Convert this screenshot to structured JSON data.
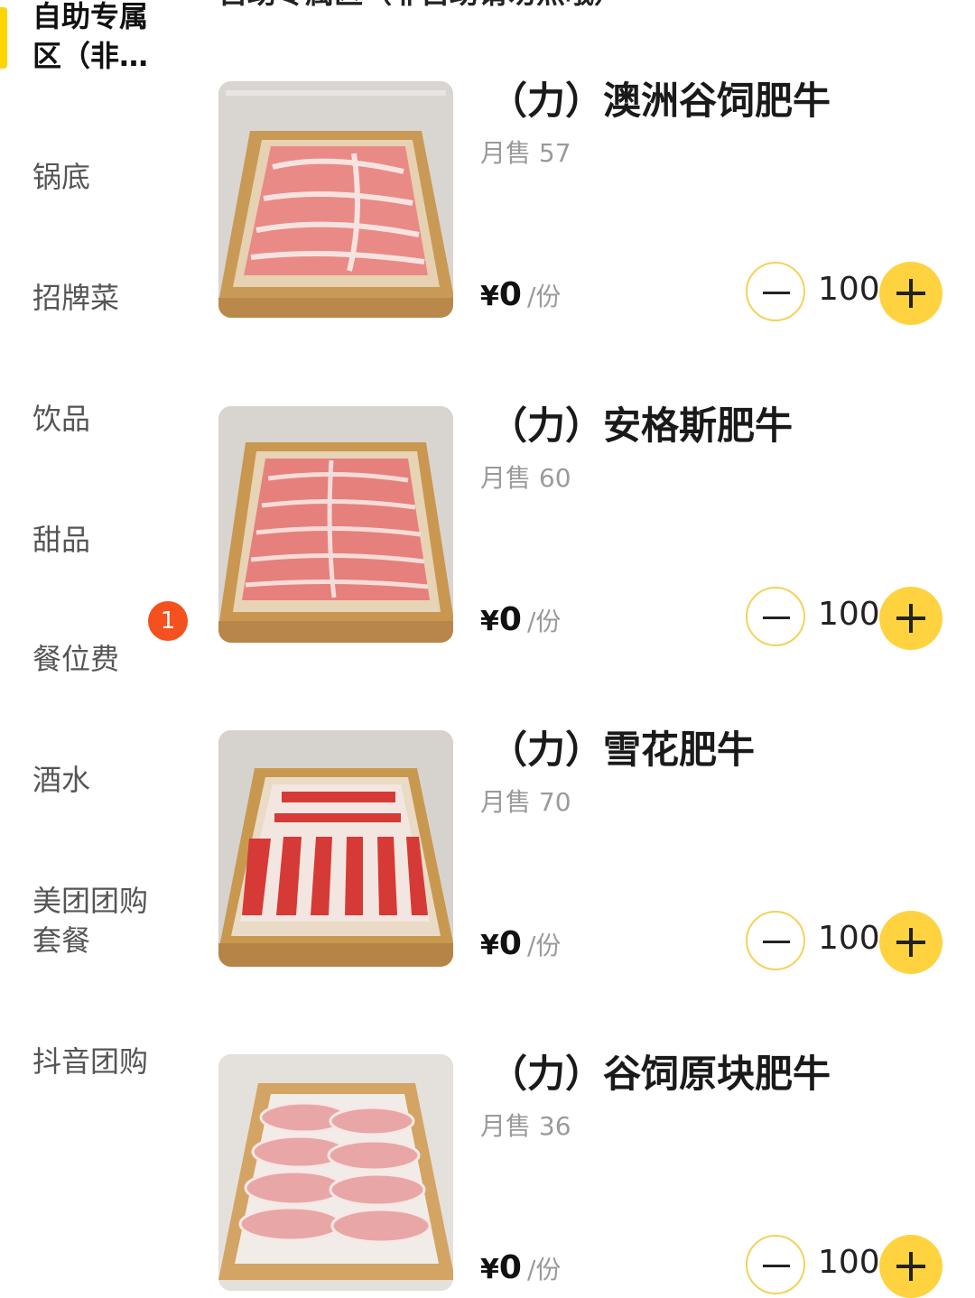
{
  "section_title": "自助专属区（非自助请勿点哦）",
  "sidebar": {
    "items": [
      {
        "label": "自助专属\n区（非…",
        "active": true
      },
      {
        "label": "锅底"
      },
      {
        "label": "招牌菜"
      },
      {
        "label": "饮品"
      },
      {
        "label": "甜品"
      },
      {
        "label": "餐位费",
        "badge": "1"
      },
      {
        "label": "酒水"
      },
      {
        "label": "美团团购\n套餐"
      },
      {
        "label": "抖音团购"
      }
    ]
  },
  "products": [
    {
      "name": "（力）澳洲谷饲肥牛",
      "sales": "月售 57",
      "currency": "¥",
      "price": "0",
      "unit": "/份",
      "qty": "100"
    },
    {
      "name": "（力）安格斯肥牛",
      "sales": "月售 60",
      "currency": "¥",
      "price": "0",
      "unit": "/份",
      "qty": "100"
    },
    {
      "name": "（力）雪花肥牛",
      "sales": "月售 70",
      "currency": "¥",
      "price": "0",
      "unit": "/份",
      "qty": "100"
    },
    {
      "name": "（力）谷饲原块肥牛",
      "sales": "月售 36",
      "currency": "¥",
      "price": "0",
      "unit": "/份",
      "qty": "100"
    }
  ],
  "colors": {
    "accent": "#ffd23f",
    "badge": "#f4511e"
  }
}
